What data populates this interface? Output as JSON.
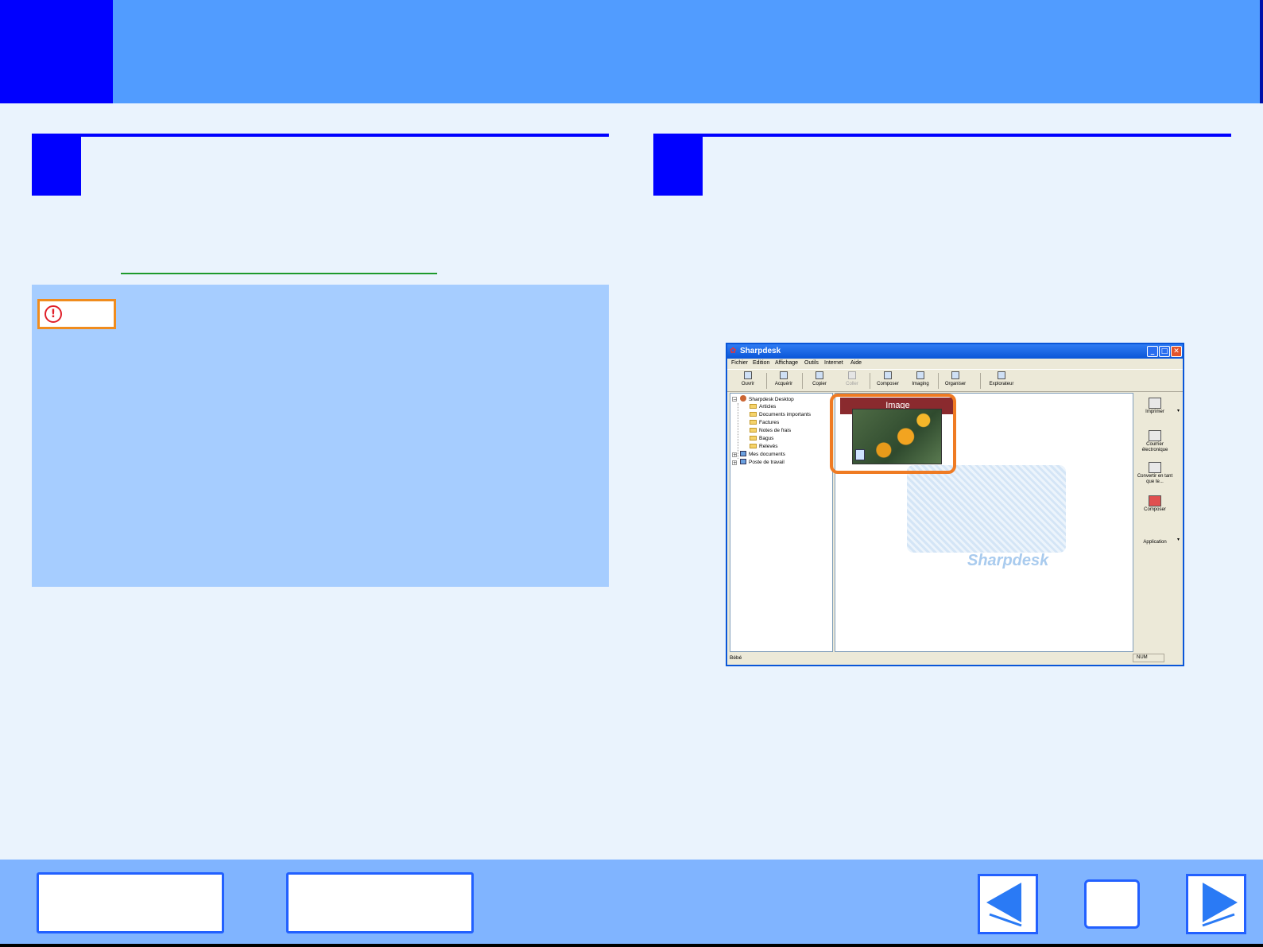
{
  "app_window": {
    "title": "Sharpdesk",
    "menu": [
      "Fichier",
      "Edition",
      "Affichage",
      "Outils",
      "Internet",
      "Aide"
    ],
    "toolbar": [
      {
        "label": "Ouvrir",
        "icon": "open-icon"
      },
      {
        "label": "Acquérir",
        "icon": "acquire-icon"
      },
      {
        "label": "Copier",
        "icon": "copy-icon"
      },
      {
        "label": "Coller",
        "icon": "paste-icon"
      },
      {
        "label": "Composer",
        "icon": "compose-icon"
      },
      {
        "label": "Imaging",
        "icon": "imaging-icon"
      },
      {
        "label": "Organiser",
        "icon": "organize-icon"
      },
      {
        "label": "Explorateur",
        "icon": "explorer-icon"
      }
    ],
    "tree": [
      {
        "label": "Sharpdesk Desktop"
      },
      {
        "label": "Articles"
      },
      {
        "label": "Documents importants"
      },
      {
        "label": "Factures"
      },
      {
        "label": "Notes de frais"
      },
      {
        "label": "Bagus"
      },
      {
        "label": "Relevés"
      },
      {
        "label": "Mes documents"
      },
      {
        "label": "Poste de travail"
      }
    ],
    "content": {
      "card_title": "Image",
      "watermark": "Sharpdesk"
    },
    "right_pane": [
      {
        "label": "Imprimer",
        "icon": "printer-icon"
      },
      {
        "label": "Courrier électronique",
        "icon": "mail-icon"
      },
      {
        "label": "Convertir en tant que te...",
        "icon": "convert-text-icon"
      },
      {
        "label": "Composer",
        "icon": "compose-icon"
      },
      {
        "label": "Application",
        "icon": ""
      }
    ],
    "status": {
      "left": "Bébé",
      "num": "NUM"
    }
  },
  "colors": {
    "page_bg": "#eaf3fd",
    "header": "#519cff",
    "accent_blue": "#0000ff",
    "caution_box": "#a6cdff",
    "caution_border": "#f08c1e",
    "highlight": "#ef7b23",
    "footer": "#80b4ff"
  }
}
